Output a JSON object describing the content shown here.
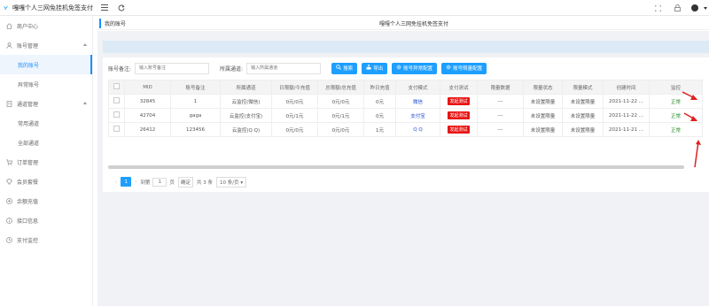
{
  "app": {
    "title": "嘎嘎个人三网免挂机免签支付"
  },
  "topbar": {
    "menu_icon": "menu-icon",
    "refresh_icon": "refresh-icon",
    "right_icons": [
      "fullscreen-icon",
      "lock-icon"
    ]
  },
  "sidebar": {
    "items": [
      {
        "label": "商户中心",
        "icon": "home-icon"
      },
      {
        "label": "账号管理",
        "icon": "user-icon",
        "expanded": true,
        "children": [
          {
            "label": "我的账号",
            "active": true
          },
          {
            "label": "异常账号"
          }
        ]
      },
      {
        "label": "通道管理",
        "icon": "doc-icon",
        "expanded": true,
        "children": [
          {
            "label": "常用通道"
          },
          {
            "label": "全部通道"
          }
        ]
      },
      {
        "label": "订单管理",
        "icon": "cart-icon"
      },
      {
        "label": "会员套餐",
        "icon": "diamond-icon"
      },
      {
        "label": "余额充值",
        "icon": "coin-icon"
      },
      {
        "label": "接口信息",
        "icon": "info-icon"
      },
      {
        "label": "支付监控",
        "icon": "monitor-icon"
      }
    ]
  },
  "tabs": {
    "active": "我的账号",
    "center_title": "嘎嘎个人三网免挂机免签支付"
  },
  "filter": {
    "remark_label": "账号备注:",
    "remark_placeholder": "输入账号备注",
    "channel_label": "所属通道:",
    "channel_placeholder": "输入所属通道",
    "buttons": [
      {
        "label": "搜索",
        "icon": "search-icon"
      },
      {
        "label": "导出",
        "icon": "export-icon"
      },
      {
        "label": "账号异常配置",
        "icon": "gear-icon"
      },
      {
        "label": "账号限量配置",
        "icon": "gear-icon"
      }
    ]
  },
  "table": {
    "columns": [
      "",
      "MID",
      "账号备注",
      "所属通道",
      "日限额/今充值",
      "总限额/总充值",
      "昨日充值",
      "支付模式",
      "支付测试",
      "限量数据",
      "限量状态",
      "限量模式",
      "创建时间",
      "监控"
    ],
    "rows": [
      [
        "",
        "32845",
        "1",
        "云监控(微信)",
        "0元/0元",
        "0元/0元",
        "0元",
        "微信",
        "发起测试",
        "---",
        "未设置限量",
        "未设置限量",
        "2021-11-22 ...",
        "正常"
      ],
      [
        "",
        "42704",
        "gaga",
        "云监控(支付宝)",
        "0元/1元",
        "0元/1元",
        "0元",
        "支付宝",
        "发起测试",
        "---",
        "未设置限量",
        "未设置限量",
        "2021-11-22 ...",
        "正常"
      ],
      [
        "",
        "26412",
        "123456",
        "云监控(Q Q)",
        "0元/0元",
        "0元/0元",
        "1元",
        "Q Q",
        "发起测试",
        "---",
        "未设置限量",
        "未设置限量",
        "2021-11-21 ...",
        "正常"
      ]
    ]
  },
  "pagination": {
    "current_page": "1",
    "goto_label": "到第",
    "goto_value": "1",
    "page_unit": "页",
    "confirm": "确定",
    "total": "共 3 条",
    "page_size": "10 条/页"
  },
  "colors": {
    "primary": "#1e9fff",
    "tag_red": "#e81414",
    "status_green": "#2e8b2e",
    "annotation_red": "#e02020"
  }
}
